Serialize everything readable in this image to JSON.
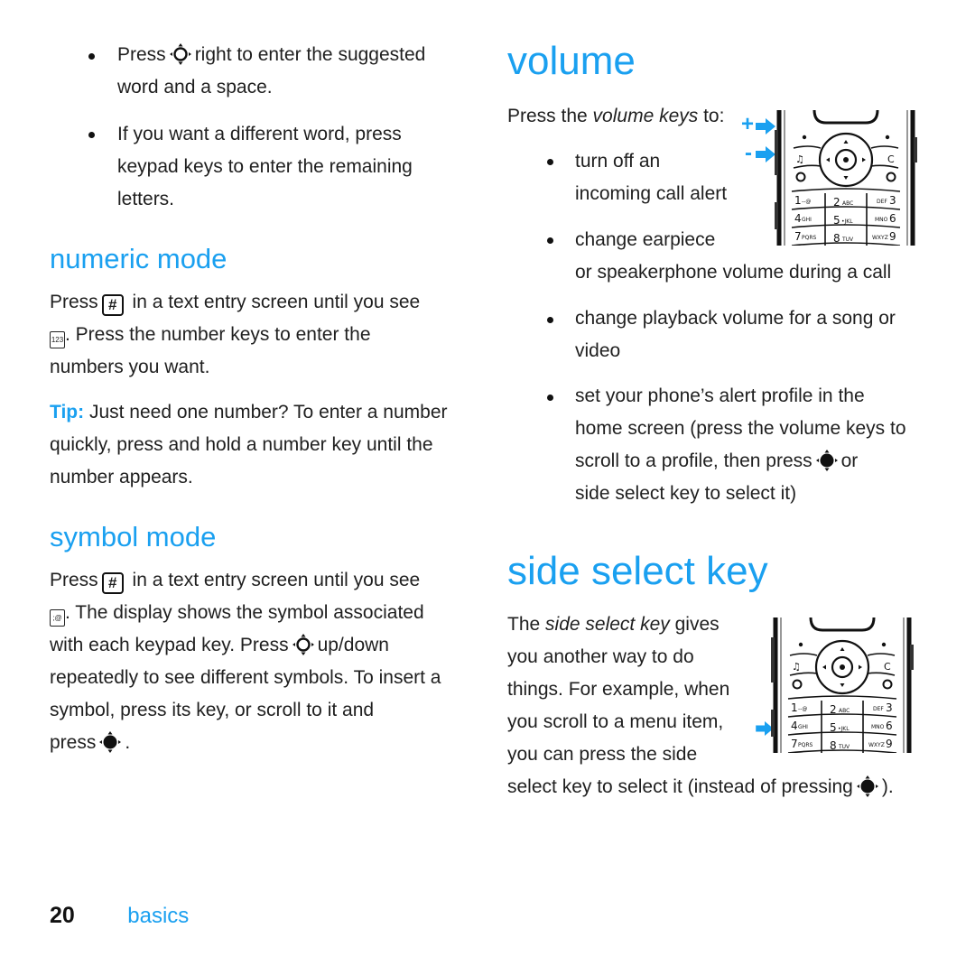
{
  "left": {
    "bullets": [
      {
        "before": "Press",
        "icon": "nav-key-outline-icon",
        "after": "right to enter the suggested",
        "line2": "word and a space."
      },
      {
        "line1": "If you want a different word, press",
        "line2": "keypad keys to enter the remaining",
        "line3": "letters."
      }
    ],
    "numeric": {
      "heading": "numeric mode",
      "p1_a": "Press",
      "key": "#",
      "p1_b": "in a text entry screen until you see",
      "indicator": "123",
      "p1_c": ". Press the number keys to enter the",
      "p1_d": "numbers you want.",
      "tip_label": "Tip:",
      "tip_a": "Just need one number? To enter a number",
      "tip_b": "quickly, press and hold a number key until the",
      "tip_c": "number appears."
    },
    "symbol": {
      "heading": "symbol mode",
      "p_a": "Press",
      "key": "#",
      "p_b": "in a text entry screen until you see",
      "indicator": ";@",
      "p_c": ". The display shows the symbol associated",
      "p_d1": "with each keypad key. Press",
      "p_d2": "up/down",
      "p_e": "repeatedly to see different symbols. To insert a",
      "p_f": "symbol, press its key, or scroll to it and",
      "p_g": "press",
      "p_g_end": "."
    }
  },
  "right": {
    "volume": {
      "heading": "volume",
      "intro_a": "Press the ",
      "intro_em": "volume keys",
      "intro_b": " to:",
      "plus": "+",
      "minus": "-",
      "b1_l1": "turn off an",
      "b1_l2": "incoming call alert",
      "b2_l1": "change earpiece",
      "b2_l2": "or speakerphone volume during a call",
      "b3_l1": "change playback volume for a song or",
      "b3_l2": "video",
      "b4_l1": "set your phone’s alert profile in the",
      "b4_l2": "home screen (press the volume keys to",
      "b4_l3a": "scroll to a profile, then press",
      "b4_l3b": "or",
      "b4_l4": "side select key to select it)"
    },
    "side": {
      "heading": "side select key",
      "l1_a": "The ",
      "l1_em": "side select key",
      "l1_b": " gives",
      "l2": "you another way to do",
      "l3": "things. For example, when",
      "l4": "you scroll to a menu item,",
      "l5": "you can press the side",
      "l6_a": "select key to select it (instead of pressing",
      "l6_b": ")."
    },
    "keypad": {
      "keys": [
        {
          "num": "1",
          "sub": "--@"
        },
        {
          "num": "2",
          "sub": "ABC"
        },
        {
          "num": "3",
          "sub": "DEF"
        },
        {
          "num": "4",
          "sub": "GHI"
        },
        {
          "num": "5",
          "sub": "JKL"
        },
        {
          "num": "6",
          "sub": "MNO"
        },
        {
          "num": "7",
          "sub": "PQRS"
        },
        {
          "num": "8",
          "sub": "TUV"
        },
        {
          "num": "9",
          "sub": "WXYZ"
        }
      ]
    }
  },
  "footer": {
    "page_number": "20",
    "section": "basics"
  },
  "colors": {
    "accent": "#1aa0f0",
    "text": "#1f1f1f"
  }
}
